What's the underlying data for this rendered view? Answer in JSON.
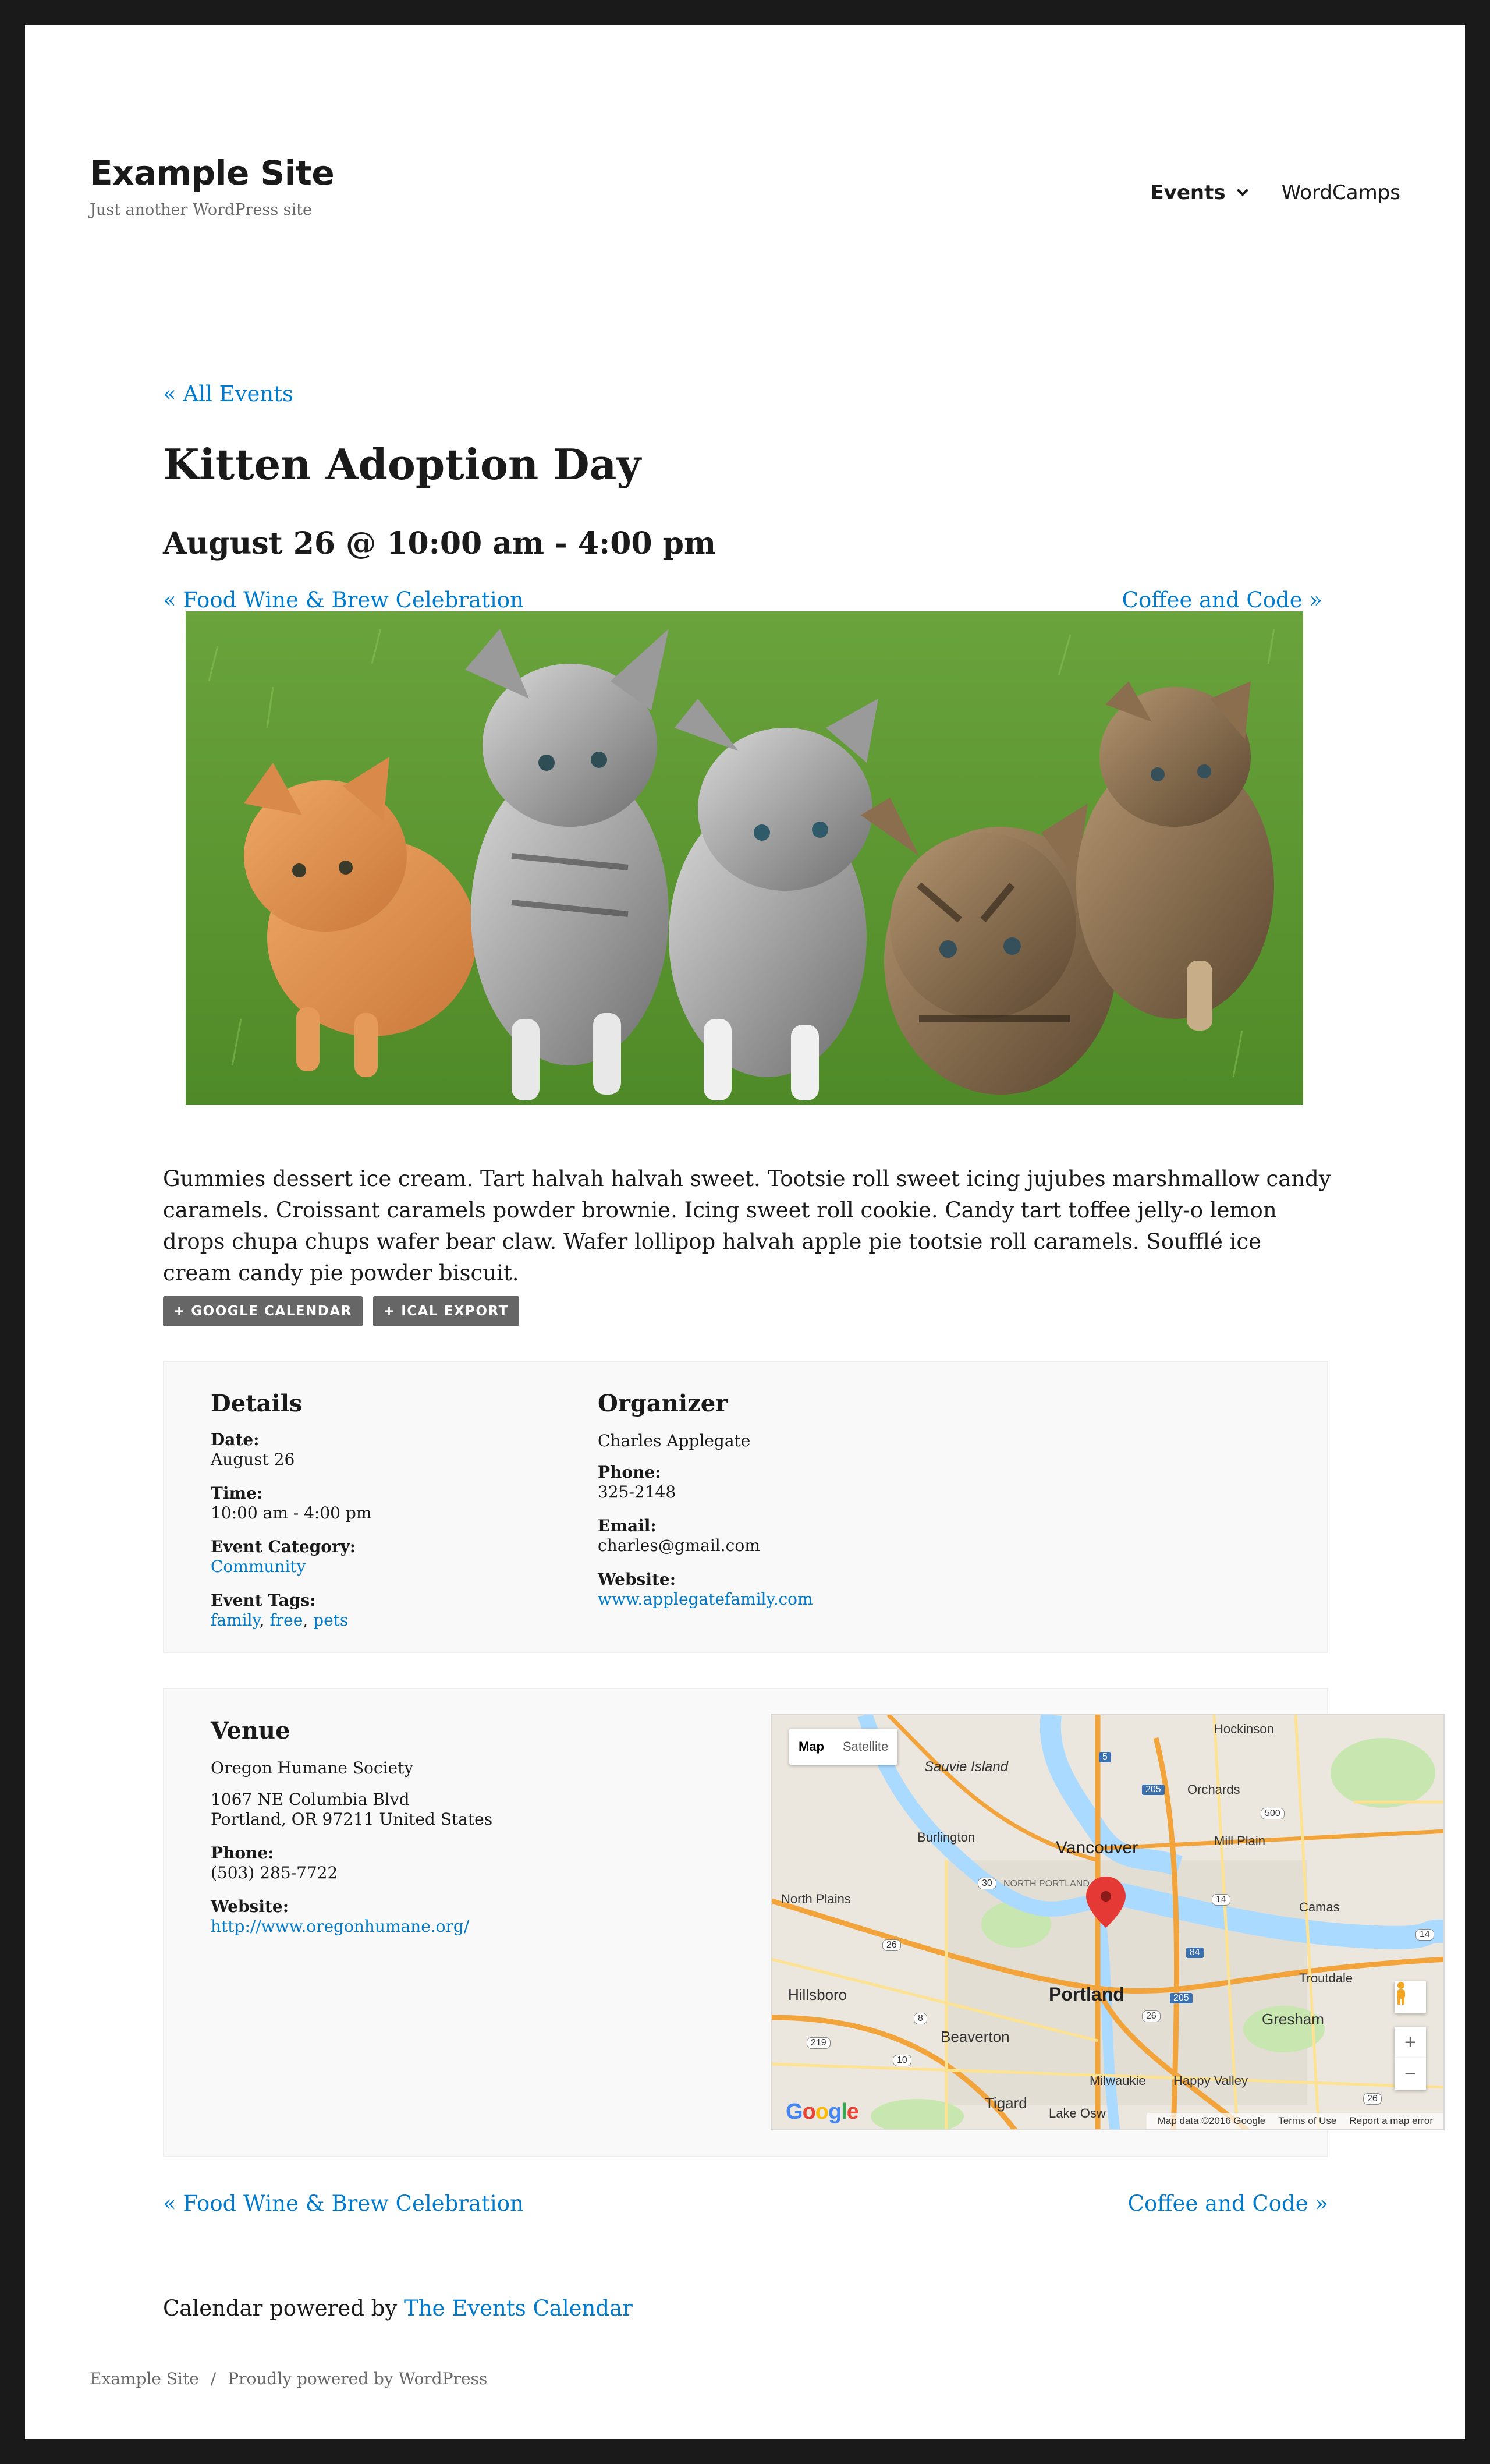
{
  "site": {
    "title": "Example Site",
    "description": "Just another WordPress site"
  },
  "nav": {
    "events_label": "Events",
    "wordcamps_label": "WordCamps"
  },
  "event": {
    "all_events_link": "« All Events",
    "title": "Kitten Adoption Day",
    "date": "August 26 @ 10:00 am - 4:00 pm",
    "prev_link": "« Food Wine & Brew Celebration",
    "next_link": "Coffee and Code »",
    "description": "Gummies dessert ice cream. Tart halvah halvah sweet. Tootsie roll sweet icing jujubes marshmallow candy caramels. Croissant caramels powder brownie. Icing sweet roll cookie. Candy tart toffee jelly-o lemon drops chupa chups wafer bear claw. Wafer lollipop halvah apple pie tootsie roll caramels. Soufflé ice cream candy pie powder biscuit.",
    "google_calendar_label": "+ GOOGLE CALENDAR",
    "ical_export_label": "+ ICAL EXPORT"
  },
  "details": {
    "title": "Details",
    "date_label": "Date:",
    "date_value": "August 26",
    "time_label": "Time:",
    "time_value": "10:00 am - 4:00 pm",
    "category_label": "Event Category:",
    "category_value": "Community",
    "tags_label": "Event Tags:",
    "tags": [
      "family",
      "free",
      "pets"
    ],
    "tag_separator": ", "
  },
  "organizer": {
    "title": "Organizer",
    "name": "Charles Applegate",
    "phone_label": "Phone:",
    "phone_value": "325-2148",
    "email_label": "Email:",
    "email_value": "charles@gmail.com",
    "website_label": "Website:",
    "website_value": "www.applegatefamily.com"
  },
  "venue": {
    "title": "Venue",
    "name": "Oregon Humane Society",
    "address_line1": "1067 NE Columbia Blvd",
    "address_line2": "Portland, OR 97211 United States",
    "phone_label": "Phone:",
    "phone_value": "(503) 285-7722",
    "website_label": "Website:",
    "website_value": "http://www.oregonhumane.org/"
  },
  "map": {
    "map_button": "Map",
    "satellite_button": "Satellite",
    "google_logo": "Google",
    "map_data": "Map data ©2016 Google",
    "terms": "Terms of Use",
    "report": "Report a map error",
    "zoom_in": "+",
    "zoom_out": "−",
    "places": {
      "hockinson": "Hockinson",
      "sauvie_island": "Sauvie Island",
      "orchards": "Orchards",
      "burlington": "Burlington",
      "vancouver": "Vancouver",
      "mill_plain": "Mill Plain",
      "north_portland": "NORTH PORTLAND",
      "north_plains": "North Plains",
      "camas": "Camas",
      "troutdale": "Troutdale",
      "hillsboro": "Hillsboro",
      "portland": "Portland",
      "gresham": "Gresham",
      "beaverton": "Beaverton",
      "milwaukie": "Milwaukie",
      "happy_valley": "Happy Valley",
      "tigard": "Tigard",
      "lake_oswego": "Lake Osw"
    },
    "shields": {
      "i5": "5",
      "i205_top": "205",
      "r500": "500",
      "r14": "14",
      "r14_right": "14",
      "r30": "30",
      "r26_left": "26",
      "i84": "84",
      "i205_mid": "205",
      "r8": "8",
      "r26_right": "26",
      "r219": "219",
      "r10": "10",
      "r26_bottom": "26"
    },
    "colors": {
      "water": "#aadaff",
      "highway": "#f2a33a",
      "road": "#fde293",
      "park": "#c8e6b0",
      "marker": "#e53935"
    }
  },
  "powered": {
    "text": "Calendar powered by ",
    "link": "The Events Calendar"
  },
  "footer": {
    "site_name": "Example Site",
    "separator": "/",
    "powered_by": "Proudly powered by WordPress"
  }
}
